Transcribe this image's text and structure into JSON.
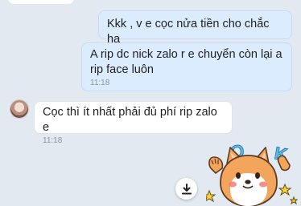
{
  "messages": [
    {
      "direction": "sent",
      "text": "Kkk , v e cọc nửa tiền cho chắc ha",
      "time": ""
    },
    {
      "direction": "sent",
      "text": "A rip dc nick zalo r e chuyển còn lại a rip face luôn",
      "time": "11:18"
    },
    {
      "direction": "received",
      "text": "Cọc thì ít nhất phải đủ phí rip zalo e",
      "time": "11:18"
    }
  ],
  "sticker": {
    "letters": [
      "O",
      "K"
    ],
    "icon": "shiba-dog-ok-sticker"
  },
  "icons": {
    "download": "download-icon",
    "avatar": "avatar"
  },
  "colors": {
    "background": "#e2e9f1",
    "sent_bubble": "#dcecff",
    "received_bubble": "#ffffff",
    "ok_letters": "#5fc0ee",
    "dog_fur": "#f3a65b",
    "stars": "#f8d23a"
  }
}
